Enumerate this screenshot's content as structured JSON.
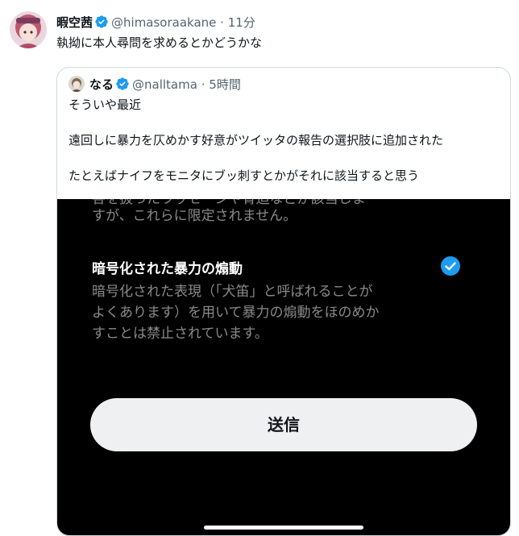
{
  "tweet": {
    "author_name": "暇空茜",
    "author_handle": "@himasoraakane",
    "separator": "·",
    "time": "11分",
    "text": "執拗に本人尋問を求めるとかどうかな",
    "avatar_icon": "avatar-icon"
  },
  "quote": {
    "author_name": "なる",
    "author_handle": "@nalltama",
    "separator": "·",
    "time": "5時間",
    "lines": [
      "そういや最近",
      "遠回しに暴力を仄めかす好意がツイッタの報告の選択肢に追加された",
      "たとえばナイフをモニタにブッ刺すとかがそれに該当すると思う"
    ],
    "avatar_icon": "avatar-icon"
  },
  "media": {
    "partial_top_line": "各を扱ったラッセージや脅迫などが該当しま",
    "line_top": "すが、これらに限定されません。",
    "option_title": "暗号化された暴力の煽動",
    "option_desc": [
      "暗号化された表現（「犬笛」と呼ばれることが",
      "よくあります）を用いて暴力の煽動をほのめか",
      "すことは禁止されています。"
    ],
    "option_checked": true,
    "submit_label": "送信"
  },
  "colors": {
    "verified": "#1d9bf0",
    "text_primary": "#0f1419",
    "text_secondary": "#536471",
    "border": "#cfd9de",
    "media_bg": "#000000"
  }
}
